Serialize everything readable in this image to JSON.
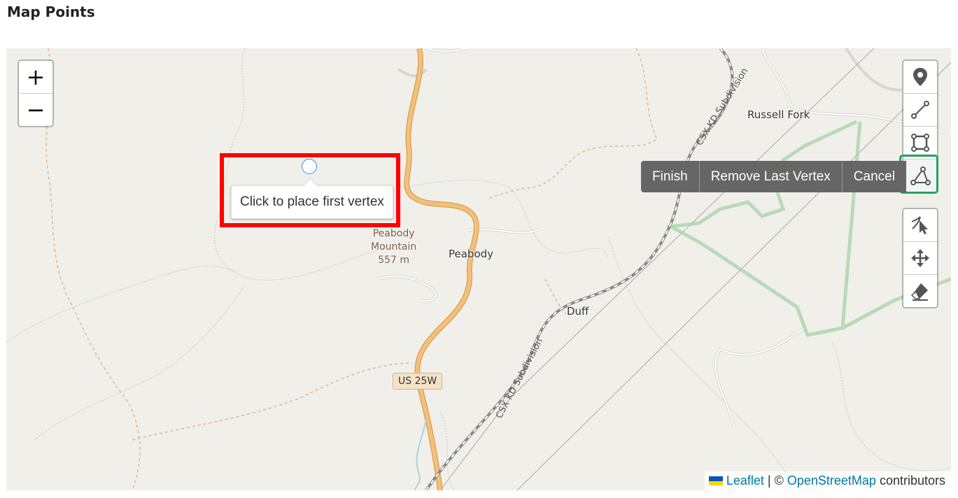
{
  "page": {
    "title": "Map Points"
  },
  "map": {
    "place_labels": {
      "russell_fork": "Russell Fork",
      "peabody": "Peabody",
      "duff": "Duff"
    },
    "peak": {
      "name_line1": "Peabody",
      "name_line2": "Mountain",
      "elevation": "557 m"
    },
    "railway_labels": {
      "upper": "CSX KD Subdivision",
      "lower": "CSX KD Subdivision"
    },
    "route_shield": "US 25W"
  },
  "zoom_control": {
    "zoom_in": "+",
    "zoom_out": "−"
  },
  "draw_toolbar": {
    "tools": [
      {
        "name": "marker",
        "icon": "map-pin-icon",
        "active": false
      },
      {
        "name": "polyline",
        "icon": "polyline-icon",
        "active": false
      },
      {
        "name": "rectangle",
        "icon": "rectangle-icon",
        "active": false
      },
      {
        "name": "polygon",
        "icon": "polygon-icon",
        "active": true
      }
    ],
    "edit_tools": [
      {
        "name": "cut",
        "icon": "cut-cursor-icon"
      },
      {
        "name": "drag",
        "icon": "move-icon"
      },
      {
        "name": "remove",
        "icon": "eraser-icon"
      }
    ],
    "actions": {
      "finish": "Finish",
      "remove_last_vertex": "Remove Last Vertex",
      "cancel": "Cancel"
    }
  },
  "draw_tooltip": "Click to place first vertex",
  "attribution": {
    "leaflet": "Leaflet",
    "separator": "| ©",
    "osm": "OpenStreetMap",
    "suffix": "contributors"
  },
  "colors": {
    "map_background": "#f1efe9",
    "highlight": "#ff0000",
    "active_tool_outline": "#21a361",
    "road": "#f6c07a",
    "boundary": "#a3d4a6"
  }
}
